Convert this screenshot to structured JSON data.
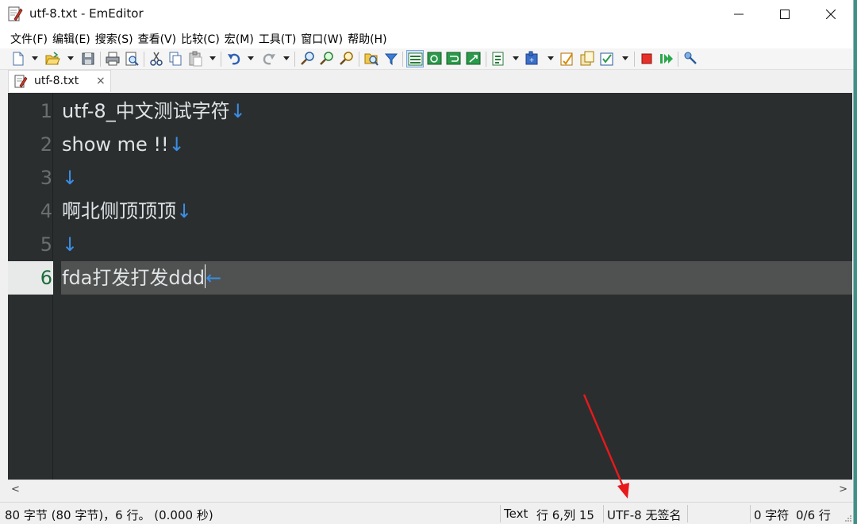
{
  "window": {
    "title": "utf-8.txt - EmEditor"
  },
  "menu": [
    {
      "label": "文件(F)"
    },
    {
      "label": "编辑(E)"
    },
    {
      "label": "搜索(S)"
    },
    {
      "label": "查看(V)"
    },
    {
      "label": "比较(C)"
    },
    {
      "label": "宏(M)"
    },
    {
      "label": "工具(T)"
    },
    {
      "label": "窗口(W)"
    },
    {
      "label": "帮助(H)"
    }
  ],
  "tab": {
    "label": "utf-8.txt",
    "close": "×"
  },
  "editor": {
    "lines": [
      {
        "num": "1",
        "text": "utf-8_中文测试字符",
        "eol": "↓"
      },
      {
        "num": "2",
        "text": "show me !!",
        "eol": "↓"
      },
      {
        "num": "3",
        "text": "",
        "eol": "↓"
      },
      {
        "num": "4",
        "text": "啊北侧顶顶顶",
        "eol": "↓"
      },
      {
        "num": "5",
        "text": "",
        "eol": "↓"
      },
      {
        "num": "6",
        "text": "fda打发打发ddd",
        "eol": "←"
      }
    ],
    "current_line": 6
  },
  "scrollbar": {
    "left": "<",
    "right": ">"
  },
  "status": {
    "summary": "80 字节 (80 字节)，6 行。 (0.000 秒)",
    "mode": "Text",
    "position": "行 6,列 15",
    "encoding": "UTF-8 无签名",
    "chars": "0 字符",
    "lines": "0/6 行"
  },
  "colors": {
    "editor_bg": "#2b2e2f",
    "text": "#e1e4e6",
    "line_number": "#6a6e70",
    "eol_marker": "#3a8ee6",
    "current_line": "#4f5250",
    "annotation_arrow": "#e8191b"
  }
}
